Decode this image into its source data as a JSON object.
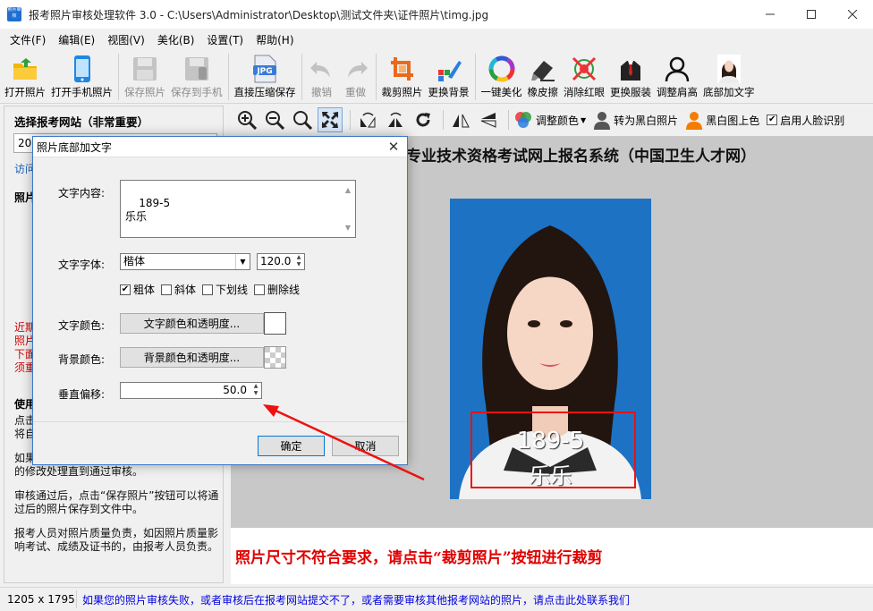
{
  "window": {
    "title": "报考照片审核处理软件 3.0 - C:\\Users\\Administrator\\Desktop\\测试文件夹\\证件照片\\timg.jpg",
    "app_icon_text": "照片审核"
  },
  "menu": [
    "文件(F)",
    "编辑(E)",
    "视图(V)",
    "美化(B)",
    "设置(T)",
    "帮助(H)"
  ],
  "toolbar": {
    "open_photo": "打开照片",
    "open_phone_photo": "打开手机照片",
    "save_photo": "保存照片",
    "save_to_phone": "保存到手机",
    "compress_save": "直接压缩保存",
    "compress_icon_text": "JPG",
    "undo": "撤销",
    "redo": "重做",
    "crop_photo": "裁剪照片",
    "change_background": "更换背景",
    "one_click_beautify": "一键美化",
    "eraser": "橡皮擦",
    "remove_red_eye": "消除红眼",
    "change_clothes": "更换服装",
    "adjust_shoulders": "调整肩高",
    "add_bottom_text": "底部加文字"
  },
  "left_panel": {
    "title": "选择报考网站（非常重要）",
    "combo_value": "20",
    "link": "访问",
    "section2": "照片",
    "red_lines": [
      "近期",
      "照片",
      "下面",
      "须重"
    ],
    "usage_title": "使用",
    "usage_lines": [
      "点击",
      "将自"
    ],
    "para1": [
      "如果",
      "的修改处理直到通过审核。"
    ],
    "para2": "审核通过后，点击“保存照片”按钮可以将通过后的照片保存到文件中。",
    "para3": "报考人员对照片质量负责，如因照片质量影响考试、成绩及证书的，由报考人员负责。"
  },
  "view_toolbar": {
    "adjust_color": "调整颜色",
    "to_bw": "转为黑白照片",
    "bw_colorize": "黑白图上色",
    "face_detect": "启用人脸识别"
  },
  "canvas": {
    "heading": "专业技术资格考试网上报名系统（中国卫生人才网）",
    "overlay_line1": "189-5",
    "overlay_line2": "乐乐",
    "bottom_message": "照片尺寸不符合要求，请点击“裁剪照片”按钮进行裁剪"
  },
  "dialog": {
    "title": "照片底部加文字",
    "content_label": "文字内容:",
    "content_value": "189-5\n乐乐",
    "font_label": "文字字体:",
    "font_value": "楷体",
    "font_size": "120.0",
    "bold": "粗体",
    "italic": "斜体",
    "underline": "下划线",
    "strikethrough": "删除线",
    "text_color_label": "文字颜色:",
    "text_color_button": "文字颜色和透明度...",
    "bg_color_label": "背景颜色:",
    "bg_color_button": "背景颜色和透明度...",
    "offset_label": "垂直偏移:",
    "offset_value": "50.0",
    "ok": "确定",
    "cancel": "取消",
    "bold_checked": true,
    "italic_checked": false,
    "underline_checked": false,
    "strikethrough_checked": false
  },
  "status": {
    "image_size": "1205 x 1795",
    "link": "如果您的照片审核失败，或者审核后在报考网站提交不了，或者需要审核其他报考网站的照片，请点击此处联系我们"
  },
  "colors": {
    "accent": "#3c79c8",
    "error_red": "#e00000",
    "photo_background": "#1d72c4",
    "link_blue": "#0000e0"
  }
}
